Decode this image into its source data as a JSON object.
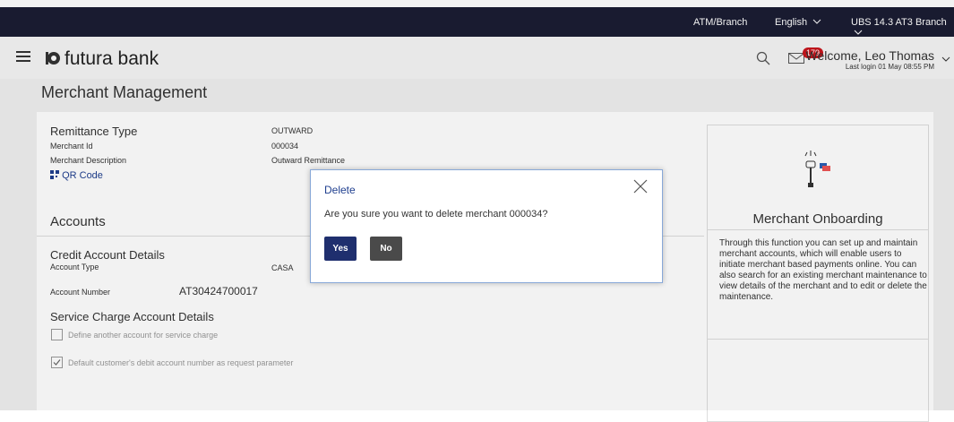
{
  "topbar": {
    "atm_branch": "ATM/Branch",
    "language": "English",
    "branch": "UBS 14.3 AT3 Branch"
  },
  "header": {
    "bank_name": "futura bank",
    "mail_count": "179",
    "welcome": "Welcome, Leo Thomas",
    "last_login": "Last login 01 May 08:55 PM"
  },
  "page": {
    "title": "Merchant Management"
  },
  "details": {
    "remittance_type_label": "Remittance Type",
    "remittance_type_value": "OUTWARD",
    "merchant_id_label": "Merchant Id",
    "merchant_id_value": "000034",
    "merchant_description_label": "Merchant Description",
    "merchant_description_value": "Outward Remittance",
    "qr_code_link": "QR Code"
  },
  "accounts": {
    "section_title": "Accounts",
    "credit_title": "Credit Account Details",
    "account_type_label": "Account Type",
    "account_type_value": "CASA",
    "account_number_label": "Account Number",
    "account_number_value": "AT30424700017",
    "service_charge_title": "Service Charge Account Details",
    "define_another": "Define another account for service charge",
    "default_customer": "Default customer's debit account number as request parameter"
  },
  "right_panel": {
    "title": "Merchant Onboarding",
    "description": "Through this function you can set up and maintain merchant accounts, which will enable users to initiate merchant based payments online. You can also search for an existing merchant maintenance to view details of the merchant and to edit or delete the maintenance."
  },
  "modal": {
    "title": "Delete",
    "message": "Are you sure you want to delete merchant 000034?",
    "yes_label": "Yes",
    "no_label": "No"
  },
  "colors": {
    "topbar": "#1b1d33",
    "primary_button": "#1f2f6e",
    "secondary_button": "#4a4a4a",
    "badge": "#c8161d"
  }
}
